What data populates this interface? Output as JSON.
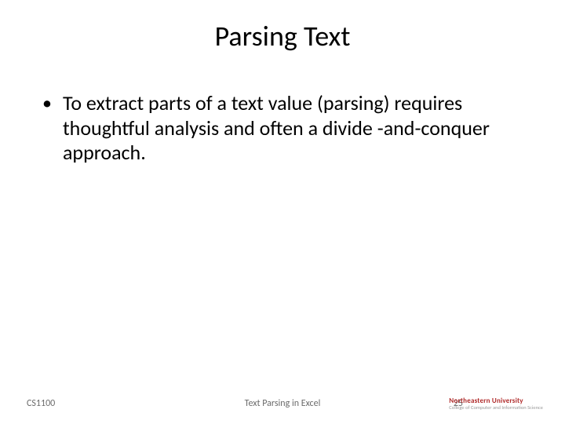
{
  "title": "Parsing Text",
  "bullet": "To extract parts of a text value (parsing) requires thoughtful analysis and often a divide -and-conquer approach.",
  "footer": {
    "left": "CS1100",
    "center": "Text Parsing in Excel",
    "page": "25",
    "logo_top": "Northeastern University",
    "logo_bottom": "College of Computer and Information Science"
  }
}
